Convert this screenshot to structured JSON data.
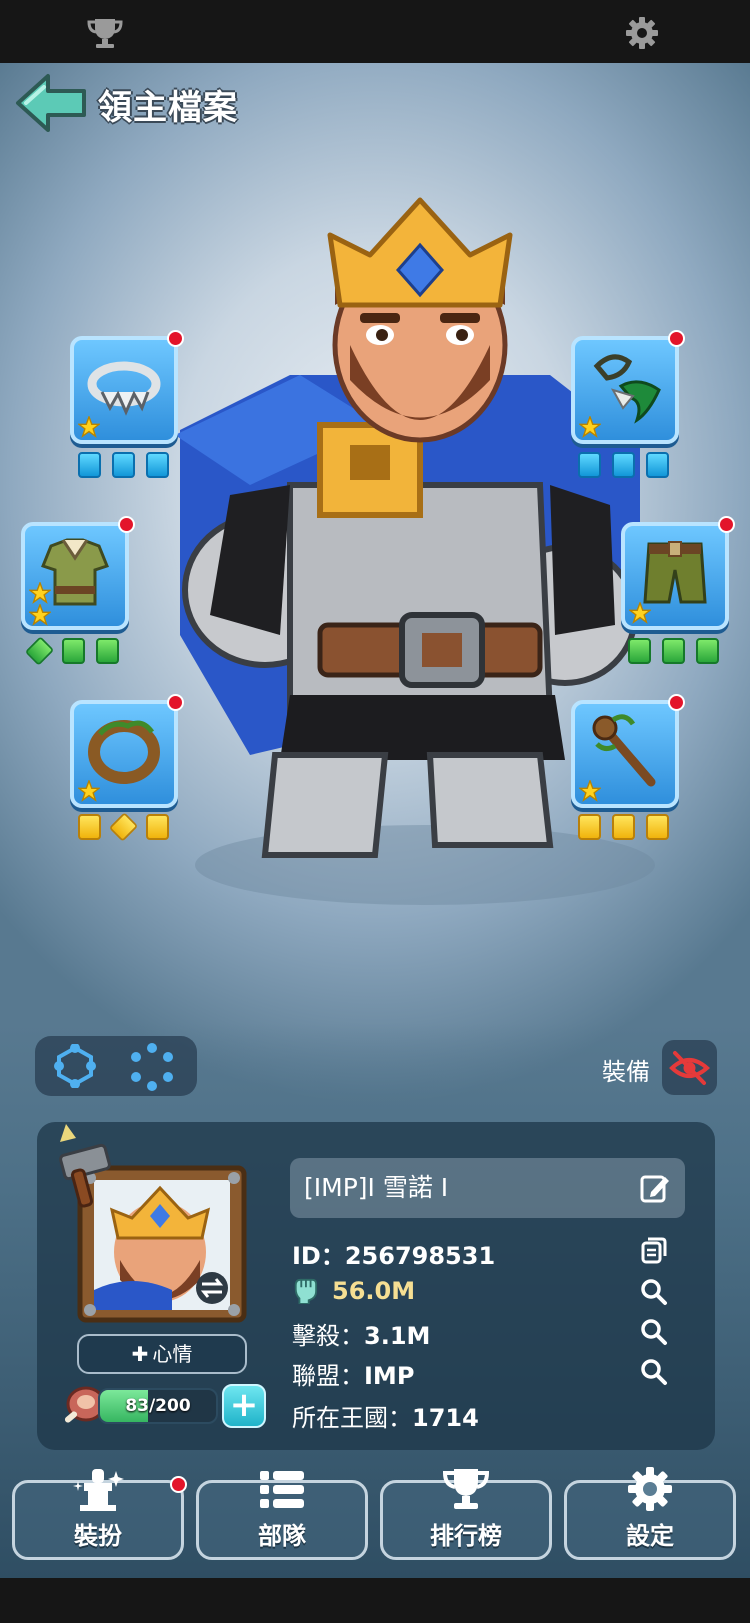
{
  "header": {
    "title": "領主檔案"
  },
  "top_icons": [
    "trophy-icon",
    "gear-icon"
  ],
  "equipment_slots": [
    {
      "slot": "necklace",
      "stars": 1,
      "gems": [
        "blue",
        "blue",
        "blue"
      ],
      "has_alert": true
    },
    {
      "slot": "weapon",
      "stars": 1,
      "gems": [
        "blue",
        "blue",
        "blue"
      ],
      "has_alert": true
    },
    {
      "slot": "armor",
      "stars": 2,
      "gems": [
        "green-diamond",
        "green",
        "green"
      ],
      "has_alert": true
    },
    {
      "slot": "pants",
      "stars": 1,
      "gems": [
        "green",
        "green",
        "green"
      ],
      "has_alert": true
    },
    {
      "slot": "ring",
      "stars": 1,
      "gems": [
        "yellow",
        "yellow-diamond",
        "yellow"
      ],
      "has_alert": true
    },
    {
      "slot": "staff",
      "stars": 1,
      "gems": [
        "yellow",
        "yellow",
        "yellow"
      ],
      "has_alert": true
    }
  ],
  "equip_toggle": {
    "label": "裝備"
  },
  "profile": {
    "mood_label": "心情",
    "food": {
      "text": "83/200",
      "current": 83,
      "max": 200
    },
    "name": "[IMP]I 雪諾 I",
    "id_label": "ID：",
    "id_value": "256798531",
    "power": "56.0M",
    "kills_label": "擊殺：",
    "kills_value": "3.1M",
    "alliance_label": "聯盟：",
    "alliance_value": "IMP",
    "kingdom_label": "所在王國：",
    "kingdom_value": "1714"
  },
  "nav": [
    {
      "label": "裝扮",
      "icon": "statue-icon",
      "alert": true
    },
    {
      "label": "部隊",
      "icon": "list-icon",
      "alert": false
    },
    {
      "label": "排行榜",
      "icon": "trophy-icon",
      "alert": false
    },
    {
      "label": "設定",
      "icon": "gear-icon",
      "alert": false
    }
  ],
  "colors": {
    "accent_blue": "#2f8fdc",
    "alert_red": "#e3142a",
    "power_gold": "#f6df93"
  }
}
